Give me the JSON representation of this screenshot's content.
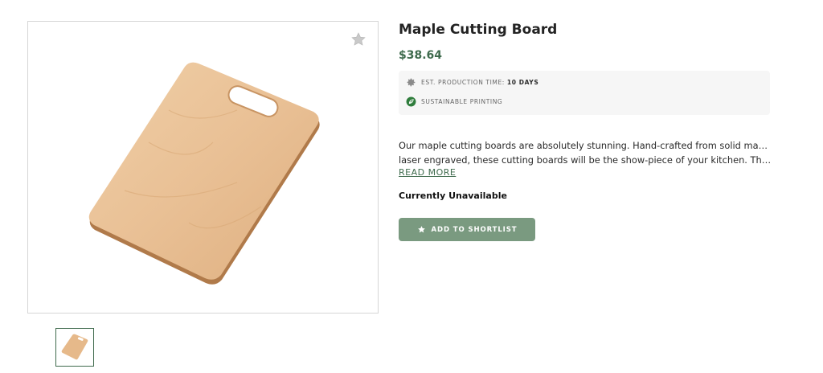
{
  "product": {
    "title": "Maple Cutting Board",
    "price": "$38.64",
    "image_alt": "Maple cutting board product photo",
    "thumbnail_alt": "Maple cutting board thumbnail"
  },
  "info": {
    "production_label": "EST. PRODUCTION TIME:",
    "production_value": "10 DAYS",
    "sustainable_label": "SUSTAINABLE PRINTING",
    "production_icon": "gear-icon",
    "sustainable_icon": "leaf-icon"
  },
  "description": {
    "line1": "Our maple cutting boards are absolutely stunning. Hand-crafted from solid maple and",
    "line2": "laser engraved, these cutting boards will be the show-piece of your kitchen. They ar...",
    "read_more": "READ MORE"
  },
  "availability": "Currently Unavailable",
  "actions": {
    "shortlist_label": "ADD TO SHORTLIST",
    "shortlist_icon": "star-icon",
    "favorite_icon": "star-icon"
  },
  "colors": {
    "accent": "#3f6b4d",
    "button": "#7a9a80",
    "info_bg": "#f6f6f6"
  }
}
